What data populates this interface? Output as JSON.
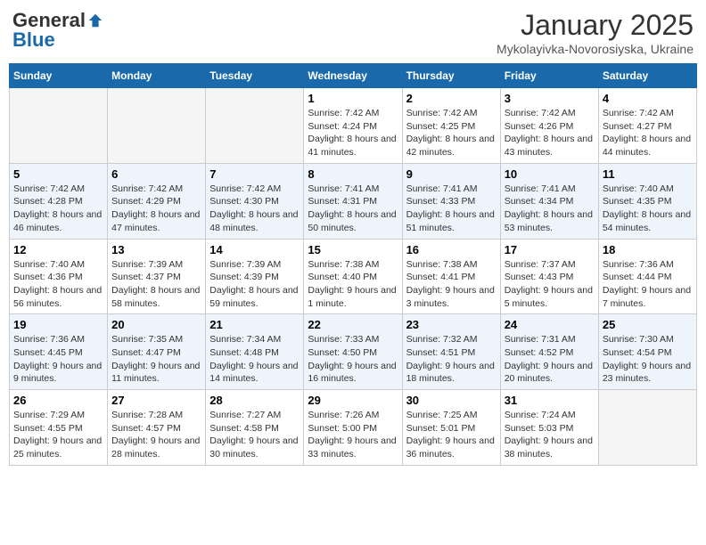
{
  "logo": {
    "general": "General",
    "blue": "Blue"
  },
  "title": "January 2025",
  "subtitle": "Mykolayivka-Novorosiyska, Ukraine",
  "days": [
    "Sunday",
    "Monday",
    "Tuesday",
    "Wednesday",
    "Thursday",
    "Friday",
    "Saturday"
  ],
  "weeks": [
    [
      {
        "day": "",
        "info": ""
      },
      {
        "day": "",
        "info": ""
      },
      {
        "day": "",
        "info": ""
      },
      {
        "day": "1",
        "info": "Sunrise: 7:42 AM\nSunset: 4:24 PM\nDaylight: 8 hours and 41 minutes."
      },
      {
        "day": "2",
        "info": "Sunrise: 7:42 AM\nSunset: 4:25 PM\nDaylight: 8 hours and 42 minutes."
      },
      {
        "day": "3",
        "info": "Sunrise: 7:42 AM\nSunset: 4:26 PM\nDaylight: 8 hours and 43 minutes."
      },
      {
        "day": "4",
        "info": "Sunrise: 7:42 AM\nSunset: 4:27 PM\nDaylight: 8 hours and 44 minutes."
      }
    ],
    [
      {
        "day": "5",
        "info": "Sunrise: 7:42 AM\nSunset: 4:28 PM\nDaylight: 8 hours and 46 minutes."
      },
      {
        "day": "6",
        "info": "Sunrise: 7:42 AM\nSunset: 4:29 PM\nDaylight: 8 hours and 47 minutes."
      },
      {
        "day": "7",
        "info": "Sunrise: 7:42 AM\nSunset: 4:30 PM\nDaylight: 8 hours and 48 minutes."
      },
      {
        "day": "8",
        "info": "Sunrise: 7:41 AM\nSunset: 4:31 PM\nDaylight: 8 hours and 50 minutes."
      },
      {
        "day": "9",
        "info": "Sunrise: 7:41 AM\nSunset: 4:33 PM\nDaylight: 8 hours and 51 minutes."
      },
      {
        "day": "10",
        "info": "Sunrise: 7:41 AM\nSunset: 4:34 PM\nDaylight: 8 hours and 53 minutes."
      },
      {
        "day": "11",
        "info": "Sunrise: 7:40 AM\nSunset: 4:35 PM\nDaylight: 8 hours and 54 minutes."
      }
    ],
    [
      {
        "day": "12",
        "info": "Sunrise: 7:40 AM\nSunset: 4:36 PM\nDaylight: 8 hours and 56 minutes."
      },
      {
        "day": "13",
        "info": "Sunrise: 7:39 AM\nSunset: 4:37 PM\nDaylight: 8 hours and 58 minutes."
      },
      {
        "day": "14",
        "info": "Sunrise: 7:39 AM\nSunset: 4:39 PM\nDaylight: 8 hours and 59 minutes."
      },
      {
        "day": "15",
        "info": "Sunrise: 7:38 AM\nSunset: 4:40 PM\nDaylight: 9 hours and 1 minute."
      },
      {
        "day": "16",
        "info": "Sunrise: 7:38 AM\nSunset: 4:41 PM\nDaylight: 9 hours and 3 minutes."
      },
      {
        "day": "17",
        "info": "Sunrise: 7:37 AM\nSunset: 4:43 PM\nDaylight: 9 hours and 5 minutes."
      },
      {
        "day": "18",
        "info": "Sunrise: 7:36 AM\nSunset: 4:44 PM\nDaylight: 9 hours and 7 minutes."
      }
    ],
    [
      {
        "day": "19",
        "info": "Sunrise: 7:36 AM\nSunset: 4:45 PM\nDaylight: 9 hours and 9 minutes."
      },
      {
        "day": "20",
        "info": "Sunrise: 7:35 AM\nSunset: 4:47 PM\nDaylight: 9 hours and 11 minutes."
      },
      {
        "day": "21",
        "info": "Sunrise: 7:34 AM\nSunset: 4:48 PM\nDaylight: 9 hours and 14 minutes."
      },
      {
        "day": "22",
        "info": "Sunrise: 7:33 AM\nSunset: 4:50 PM\nDaylight: 9 hours and 16 minutes."
      },
      {
        "day": "23",
        "info": "Sunrise: 7:32 AM\nSunset: 4:51 PM\nDaylight: 9 hours and 18 minutes."
      },
      {
        "day": "24",
        "info": "Sunrise: 7:31 AM\nSunset: 4:52 PM\nDaylight: 9 hours and 20 minutes."
      },
      {
        "day": "25",
        "info": "Sunrise: 7:30 AM\nSunset: 4:54 PM\nDaylight: 9 hours and 23 minutes."
      }
    ],
    [
      {
        "day": "26",
        "info": "Sunrise: 7:29 AM\nSunset: 4:55 PM\nDaylight: 9 hours and 25 minutes."
      },
      {
        "day": "27",
        "info": "Sunrise: 7:28 AM\nSunset: 4:57 PM\nDaylight: 9 hours and 28 minutes."
      },
      {
        "day": "28",
        "info": "Sunrise: 7:27 AM\nSunset: 4:58 PM\nDaylight: 9 hours and 30 minutes."
      },
      {
        "day": "29",
        "info": "Sunrise: 7:26 AM\nSunset: 5:00 PM\nDaylight: 9 hours and 33 minutes."
      },
      {
        "day": "30",
        "info": "Sunrise: 7:25 AM\nSunset: 5:01 PM\nDaylight: 9 hours and 36 minutes."
      },
      {
        "day": "31",
        "info": "Sunrise: 7:24 AM\nSunset: 5:03 PM\nDaylight: 9 hours and 38 minutes."
      },
      {
        "day": "",
        "info": ""
      }
    ]
  ]
}
